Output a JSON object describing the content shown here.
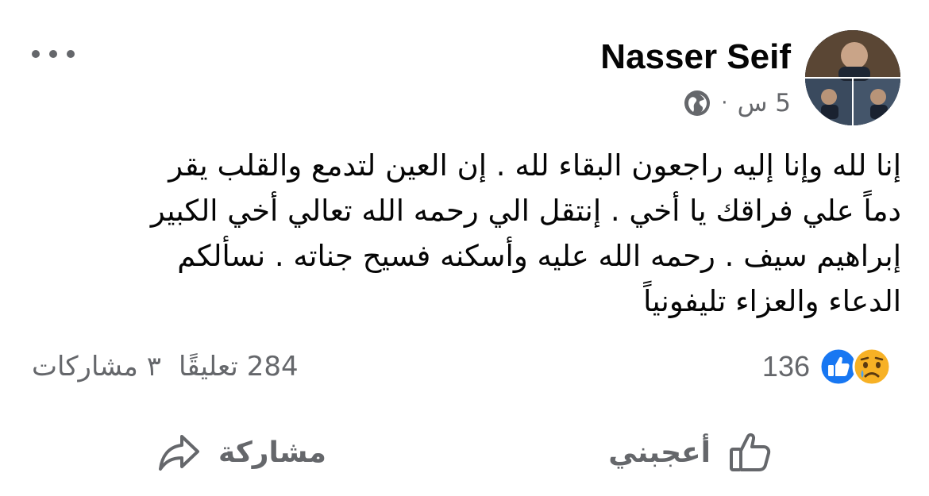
{
  "post": {
    "author": "Nasser Seif",
    "time": "5 س",
    "separator": "·",
    "privacy_icon": "globe-icon",
    "text": "إنا لله وإنا إليه راجعون البقاء لله . إن العين  لتدمع والقلب يقر\nدماً علي فراقك يا أخي . إنتقل الي رحمه الله تعالي أخي الكبير\nإبراهيم سيف . رحمه الله عليه وأسكنه فسيح جناته . نسألكم\nالدعاء والعزاء تليفونياً"
  },
  "stats": {
    "reaction_icons": [
      "sad-reaction-icon",
      "like-reaction-icon"
    ],
    "reaction_count": "136",
    "comments": "284 تعليقًا",
    "shares": "٣ مشاركات"
  },
  "actions": {
    "like_label": "أعجبني",
    "like_icon": "thumbs-up-icon",
    "share_label": "مشاركة",
    "share_icon": "share-arrow-icon"
  },
  "colors": {
    "text_primary": "#050505",
    "text_secondary": "#65676b",
    "like_blue": "#1877f2",
    "sad_yellow": "#f7b125"
  }
}
